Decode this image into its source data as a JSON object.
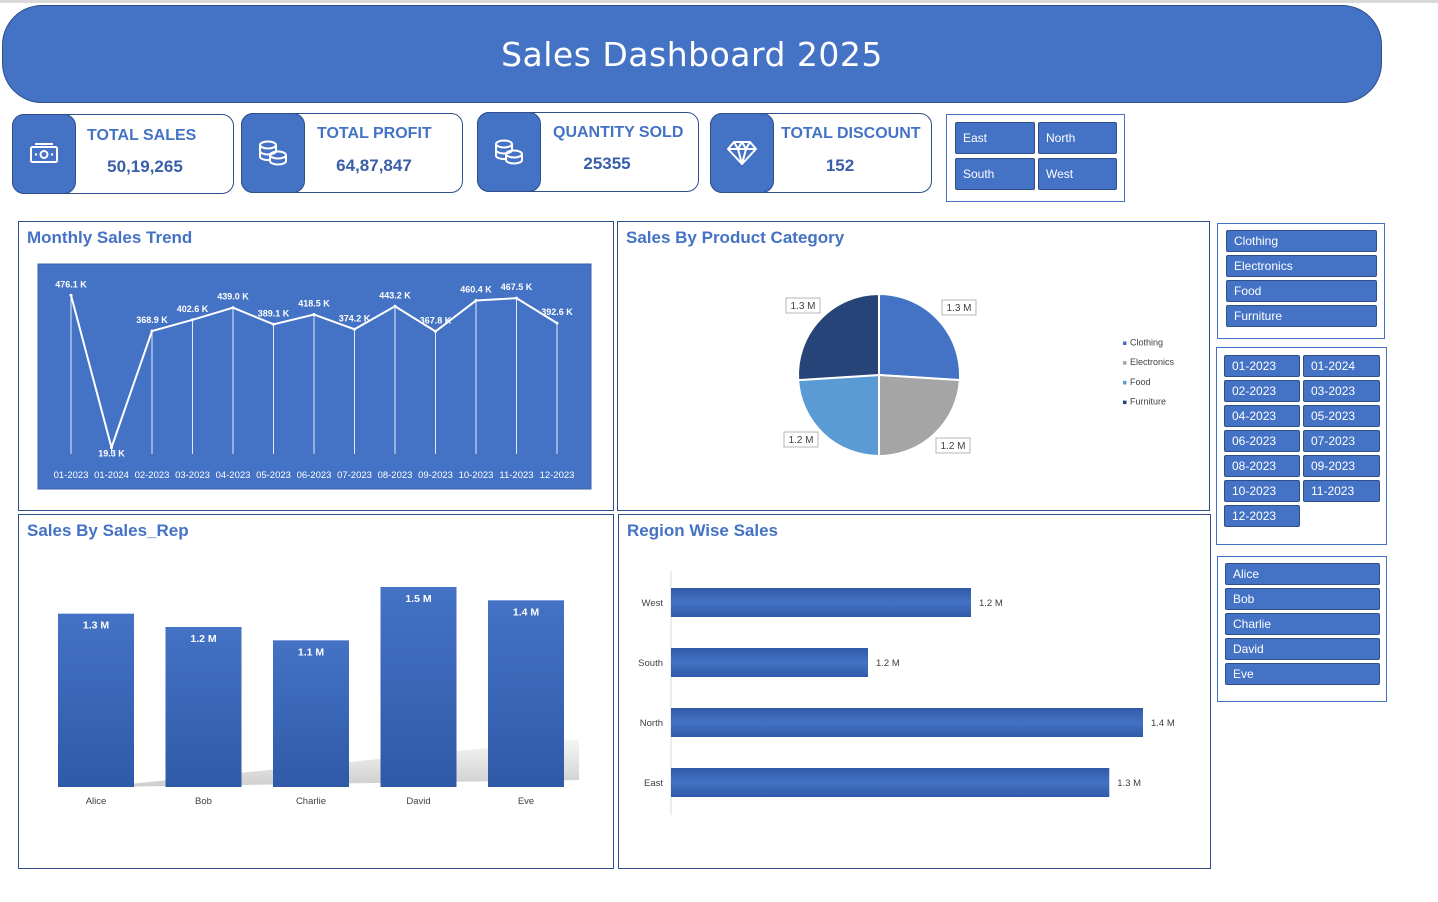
{
  "title": "Sales Dashboard 2025",
  "kpis": [
    {
      "label": "TOTAL SALES",
      "value": "50,19,265",
      "icon": "money-icon"
    },
    {
      "label": "TOTAL PROFIT",
      "value": "64,87,847",
      "icon": "coins-icon"
    },
    {
      "label": "QUANTITY SOLD",
      "value": "25355",
      "icon": "coins-icon"
    },
    {
      "label": "TOTAL DISCOUNT",
      "value": "152",
      "icon": "diamond-icon"
    }
  ],
  "region_slicer": [
    "East",
    "North",
    "South",
    "West"
  ],
  "category_slicer": [
    "Clothing",
    "Electronics",
    "Food",
    "Furniture"
  ],
  "month_slicer": [
    "01-2023",
    "01-2024",
    "02-2023",
    "03-2023",
    "04-2023",
    "05-2023",
    "06-2023",
    "07-2023",
    "08-2023",
    "09-2023",
    "10-2023",
    "11-2023",
    "12-2023"
  ],
  "rep_slicer": [
    "Alice",
    "Bob",
    "Charlie",
    "David",
    "Eve"
  ],
  "colors": {
    "primary": "#4472c4",
    "dark": "#2f4f8a",
    "navy": "#264478",
    "gray": "#a5a5a5",
    "light_blue": "#5b9bd5"
  },
  "chart_data": [
    {
      "type": "line",
      "title": "Monthly Sales Trend",
      "categories": [
        "01-2023",
        "01-2024",
        "02-2023",
        "03-2023",
        "04-2023",
        "05-2023",
        "06-2023",
        "07-2023",
        "08-2023",
        "09-2023",
        "10-2023",
        "11-2023",
        "12-2023"
      ],
      "values": [
        476.1,
        19.3,
        368.9,
        402.6,
        439.0,
        389.1,
        418.5,
        374.2,
        443.2,
        367.8,
        460.4,
        467.5,
        392.6
      ],
      "labels": [
        "476.1 K",
        "19.3 K",
        "368.9 K",
        "402.6 K",
        "439.0 K",
        "389.1 K",
        "418.5 K",
        "374.2 K",
        "443.2 K",
        "367.8 K",
        "460.4 K",
        "467.5 K",
        "392.6 K"
      ],
      "grid": false
    },
    {
      "type": "pie",
      "title": "Sales By Product Category",
      "categories": [
        "Clothing",
        "Electronics",
        "Food",
        "Furniture"
      ],
      "values": [
        1.3,
        1.2,
        1.2,
        1.3
      ],
      "labels": [
        "1.3 M",
        "1.2 M",
        "1.2 M",
        "1.3 M"
      ],
      "colors": [
        "#4472c4",
        "#a5a5a5",
        "#5b9bd5",
        "#264478"
      ],
      "legend": "right"
    },
    {
      "type": "bar",
      "title": "Sales By Sales_Rep",
      "categories": [
        "Alice",
        "Bob",
        "Charlie",
        "David",
        "Eve"
      ],
      "values": [
        1.3,
        1.2,
        1.1,
        1.5,
        1.4
      ],
      "labels": [
        "1.3 M",
        "1.2 M",
        "1.1 M",
        "1.5 M",
        "1.4 M"
      ]
    },
    {
      "type": "bar",
      "orientation": "horizontal",
      "title": "Region Wise Sales",
      "categories": [
        "West",
        "South",
        "North",
        "East"
      ],
      "values": [
        1.2,
        1.2,
        1.4,
        1.3
      ],
      "labels": [
        "1.2 M",
        "1.2 M",
        "1.4 M",
        "1.3 M"
      ]
    }
  ]
}
